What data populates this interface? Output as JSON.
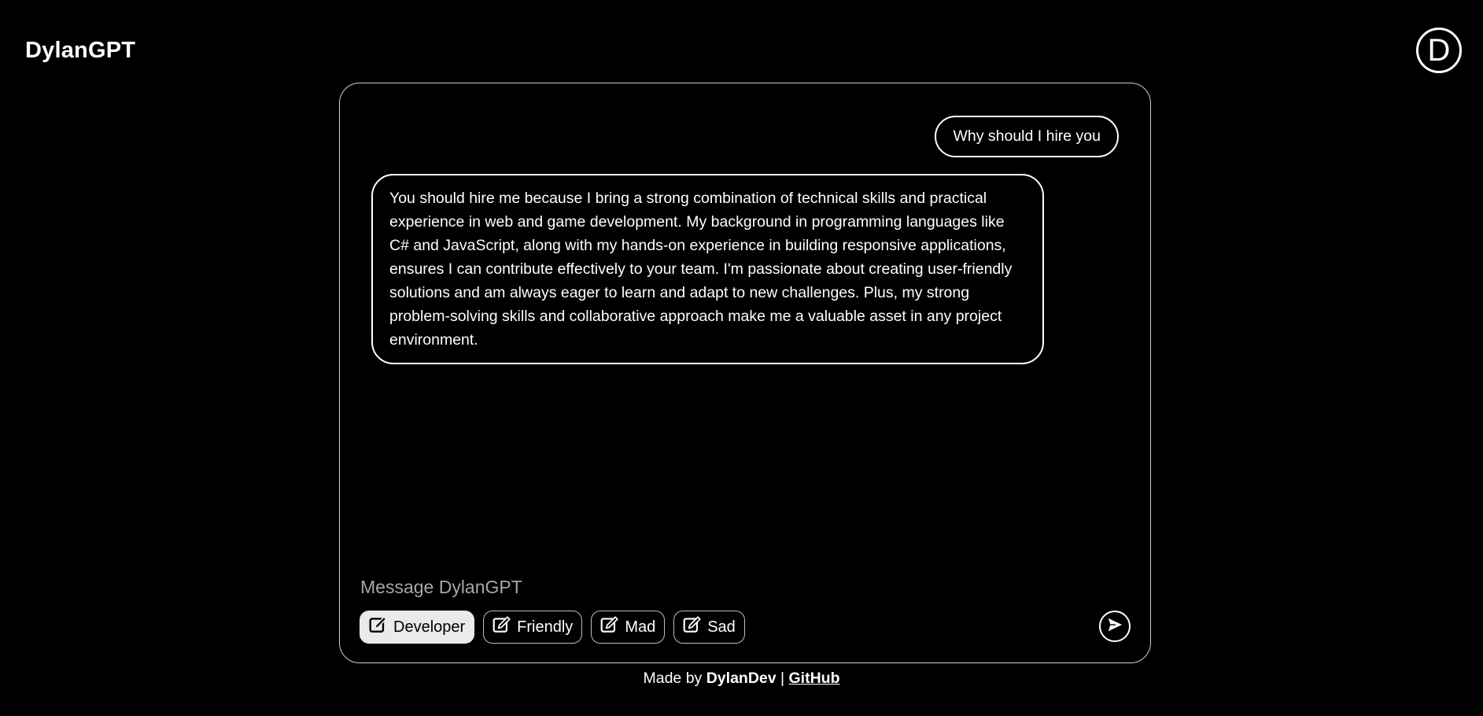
{
  "header": {
    "title": "DylanGPT",
    "avatar_letter": "D"
  },
  "chat": {
    "messages": [
      {
        "role": "user",
        "text": "Why should I hire you"
      },
      {
        "role": "assistant",
        "text": "You should hire me because I bring a strong combination of technical skills and practical experience in web and game development. My background in programming languages like C# and JavaScript, along with my hands-on experience in building responsive applications, ensures I can contribute effectively to your team. I'm passionate about creating user-friendly solutions and am always eager to learn and adapt to new challenges. Plus, my strong problem-solving skills and collaborative approach make me a valuable asset in any project environment."
      }
    ],
    "input": {
      "placeholder": "Message DylanGPT",
      "value": ""
    },
    "personas": [
      {
        "label": "Developer",
        "selected": true,
        "icon": "edit-icon"
      },
      {
        "label": "Friendly",
        "selected": false,
        "icon": "edit-icon"
      },
      {
        "label": "Mad",
        "selected": false,
        "icon": "edit-icon"
      },
      {
        "label": "Sad",
        "selected": false,
        "icon": "edit-icon"
      }
    ],
    "send_icon": "send-icon"
  },
  "footer": {
    "prefix": "Made by ",
    "author": "DylanDev",
    "separator": " | ",
    "link_label": "GitHub"
  }
}
